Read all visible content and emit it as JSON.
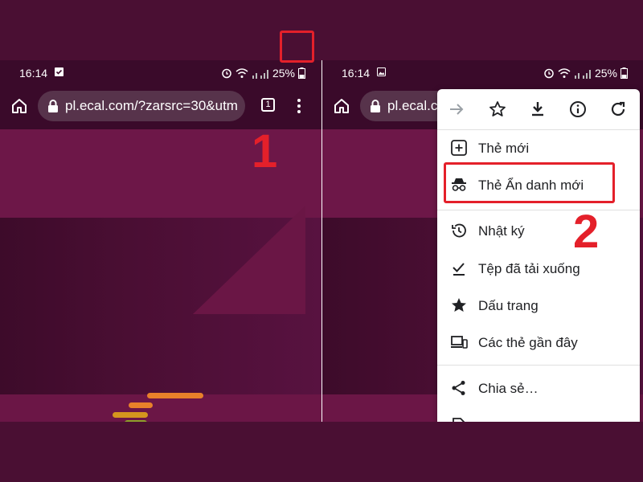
{
  "left": {
    "status": {
      "time": "16:14",
      "battery": "25%"
    },
    "url": "pl.ecal.com/?zarsrc=30&utm",
    "tab_count": "1",
    "step": "1"
  },
  "right": {
    "status": {
      "time": "16:14",
      "battery": "25%"
    },
    "url": "pl.ecal.c",
    "step": "2",
    "menu": {
      "icons": [
        "forward-icon",
        "star-icon",
        "download-icon",
        "info-icon",
        "refresh-icon"
      ],
      "items": [
        {
          "label": "Thẻ mới",
          "icon": "new-tab-icon"
        },
        {
          "label": "Thẻ Ẩn danh mới",
          "icon": "incognito-icon"
        },
        {
          "label": "Nhật ký",
          "icon": "history-icon"
        },
        {
          "label": "Tệp đã tải xuống",
          "icon": "downloads-icon"
        },
        {
          "label": "Dấu trang",
          "icon": "bookmark-star-icon"
        },
        {
          "label": "Các thẻ gần đây",
          "icon": "recent-tabs-icon"
        },
        {
          "label": "Chia sẻ…",
          "icon": "share-icon"
        }
      ]
    }
  },
  "colors": {
    "page_bg": "#4a0f33",
    "chrome_bar": "#3a0a2a",
    "highlight": "#e4202a",
    "bar_orange": "#e8812a",
    "bar_yellow": "#d4951e"
  }
}
